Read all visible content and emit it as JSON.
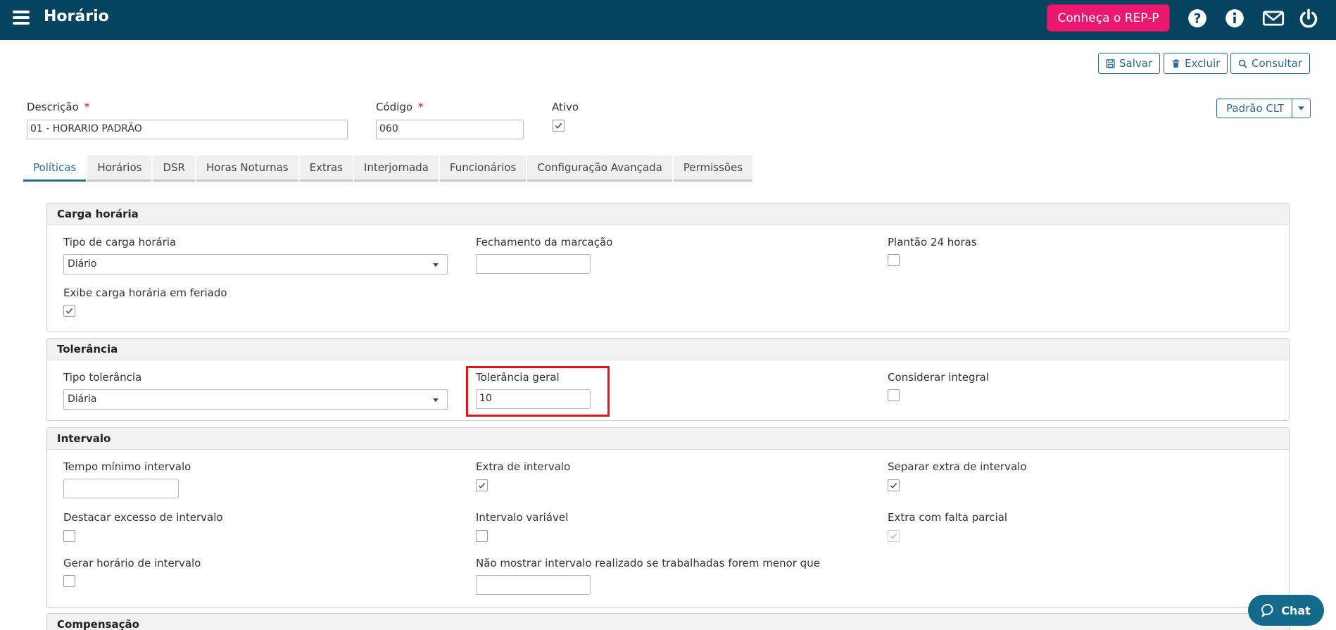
{
  "header": {
    "title": "Horário",
    "rep_button": "Conheça o REP-P",
    "icons": [
      "menu-icon",
      "help-icon",
      "info-icon",
      "mail-icon",
      "power-icon"
    ]
  },
  "toolbar": {
    "save": "Salvar",
    "delete": "Excluir",
    "search": "Consultar"
  },
  "form": {
    "descricao_label": "Descrição",
    "descricao_value": "01 - HORARIO PADRÃO",
    "codigo_label": "Código",
    "codigo_value": "060",
    "ativo_label": "Ativo",
    "ativo_checked": true,
    "required_mark": "*",
    "template_button": "Padrão CLT"
  },
  "tabs": [
    "Políticas",
    "Horários",
    "DSR",
    "Horas Noturnas",
    "Extras",
    "Interjornada",
    "Funcionários",
    "Configuração Avançada",
    "Permissões"
  ],
  "active_tab": "Políticas",
  "carga": {
    "title": "Carga horária",
    "tipo_label": "Tipo de carga horária",
    "tipo_value": "Diário",
    "fechamento_label": "Fechamento da marcação",
    "fechamento_value": "",
    "plantao_label": "Plantão 24 horas",
    "plantao_checked": false,
    "feriado_label": "Exibe carga horária em feriado",
    "feriado_checked": true
  },
  "tolerancia": {
    "title": "Tolerância",
    "tipo_label": "Tipo tolerância",
    "tipo_value": "Diária",
    "geral_label": "Tolerância geral",
    "geral_value": "10",
    "integral_label": "Considerar integral",
    "integral_checked": false
  },
  "intervalo": {
    "title": "Intervalo",
    "tempo_label": "Tempo mínimo intervalo",
    "tempo_value": "",
    "extra_label": "Extra de intervalo",
    "extra_checked": true,
    "separar_label": "Separar extra de intervalo",
    "separar_checked": true,
    "destacar_label": "Destacar excesso de intervalo",
    "destacar_checked": false,
    "variavel_label": "Intervalo variável",
    "variavel_checked": false,
    "falta_label": "Extra com falta parcial",
    "falta_checked": true,
    "gerar_label": "Gerar horário de intervalo",
    "gerar_checked": false,
    "nao_mostrar_label": "Não mostrar intervalo realizado se trabalhadas forem menor que",
    "nao_mostrar_value": ""
  },
  "compensacao": {
    "title": "Compensação"
  },
  "chat": {
    "label": "Chat"
  },
  "colors": {
    "topbar": "#05435f",
    "accent": "#2b6b8e",
    "rep": "#e8196e",
    "required": "#e2002b",
    "chat": "#136a8a"
  }
}
